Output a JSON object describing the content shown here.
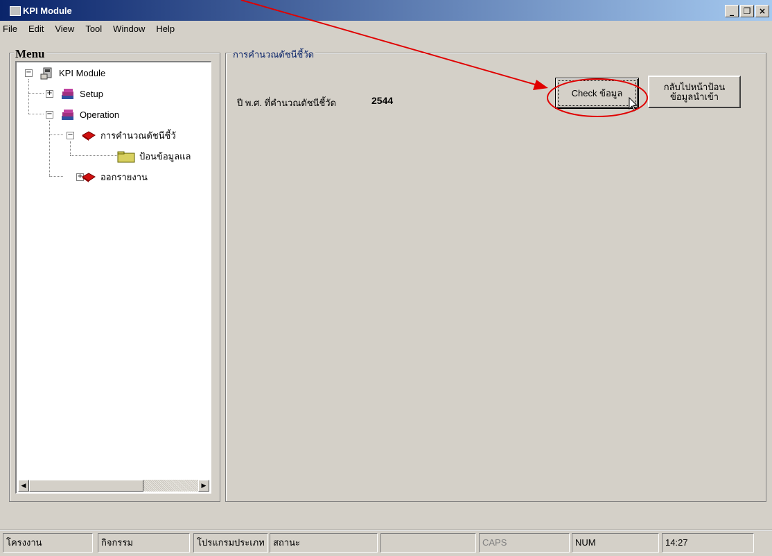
{
  "window": {
    "title": "KPI Module",
    "controls": {
      "minimize": "_",
      "restore": "❐",
      "close": "×"
    }
  },
  "menubar": {
    "items": [
      "File",
      "Edit",
      "View",
      "Tool",
      "Window",
      "Help"
    ]
  },
  "sidebar": {
    "label": "Menu",
    "tree": {
      "root": "KPI Module",
      "setup": "Setup",
      "operation": "Operation",
      "calc": "การคำนวณดัชนีชี้วั",
      "input": "ป้อนข้อมูลแล",
      "report": "ออกรายงาน"
    }
  },
  "main": {
    "group_label": "การคำนวณดัชนีชี้วัด",
    "year_label": "ปี พ.ศ. ที่คำนวณดัชนีชี้วัด",
    "year_value": "2544",
    "check_button": "Check ข้อมูล",
    "back_button_line1": "กลับไปหน้าป้อน",
    "back_button_line2": "ข้อมูลนำเข้า"
  },
  "statusbar": {
    "panels": [
      "โครงงาน",
      "กิจกรรม",
      "โปรแกรมประเภท",
      "สถานะ",
      "",
      "CAPS",
      "NUM",
      "14:27"
    ]
  },
  "colors": {
    "titlebar_start": "#0a246a",
    "titlebar_end": "#a6caf0",
    "window_bg": "#d4d0c8",
    "group_label": "#0a246a",
    "annotation": "#e00000"
  }
}
